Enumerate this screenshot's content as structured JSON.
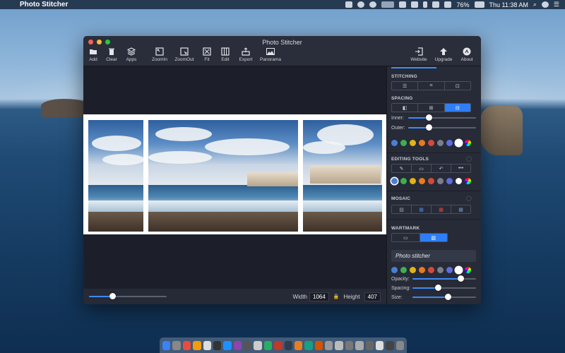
{
  "menubar": {
    "app_name": "Photo Stitcher",
    "battery": "76%",
    "clock": "Thu 11:38 AM"
  },
  "window": {
    "title": "Photo Stitcher",
    "toolbar": {
      "add": "Add",
      "clear": "Clear",
      "apps": "Apps",
      "zoom_in": "ZoomIn",
      "zoom_out": "ZoomOut",
      "fit": "Fit",
      "edit": "Edit",
      "export": "Export",
      "panorama": "Panorama",
      "website": "Website",
      "upgrade": "Upgrade",
      "about": "About"
    }
  },
  "bottom": {
    "width_label": "Width",
    "width_value": "1064",
    "height_label": "Height",
    "height_value": "407",
    "zoom_level": 0.3
  },
  "sidebar": {
    "stitching_title": "STITCHING",
    "spacing_title": "SPACING",
    "inner_label": "Inner:",
    "inner_value": 0.3,
    "outer_label": "Outer:",
    "outer_value": 0.3,
    "editing_title": "EDITING TOOLS",
    "mosaic_title": "MOSAIC",
    "watermark_title": "WARTMARK",
    "watermark_text": "Photo stitcher",
    "opacity_label": "Opacity:",
    "opacity_value": 0.75,
    "spacing_label": "Spacing:",
    "spacing_value": 0.4,
    "size_label": "Size:",
    "size_value": 0.55,
    "colors": [
      "#4a7fd4",
      "#3fae4f",
      "#e0b318",
      "#e87b1c",
      "#d44a3a",
      "#7a7f8c",
      "#5f6de0",
      "#ffffff"
    ]
  }
}
